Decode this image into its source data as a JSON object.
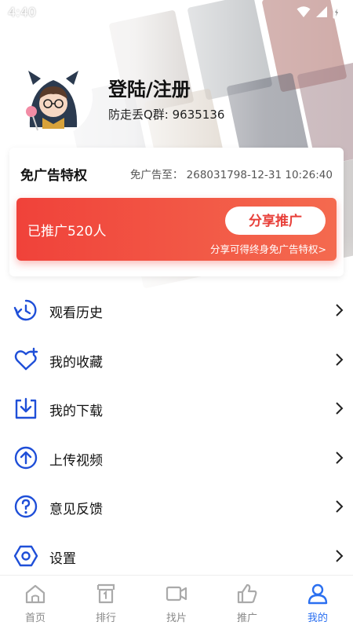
{
  "status_bar": {
    "time": "4:40"
  },
  "profile": {
    "title": "登陆/注册",
    "qq_group": "防走丢Q群: 9635136"
  },
  "adfree": {
    "title": "免广告特权",
    "until": "免广告至： 268031798-12-31 10:26:40",
    "promo": {
      "count_text": "已推广520人",
      "share_button": "分享推广",
      "hint": "分享可得终身免广告特权>"
    }
  },
  "menu": {
    "items": [
      {
        "label": "观看历史",
        "icon": "history-icon"
      },
      {
        "label": "我的收藏",
        "icon": "heart-plus-icon"
      },
      {
        "label": "我的下载",
        "icon": "download-icon"
      },
      {
        "label": "上传视频",
        "icon": "upload-icon"
      },
      {
        "label": "意见反馈",
        "icon": "question-icon"
      },
      {
        "label": "设置",
        "icon": "settings-icon"
      }
    ]
  },
  "bottom_nav": {
    "items": [
      {
        "label": "首页",
        "icon": "home-icon",
        "active": false
      },
      {
        "label": "排行",
        "icon": "ranking-icon",
        "active": false
      },
      {
        "label": "找片",
        "icon": "video-camera-icon",
        "active": false
      },
      {
        "label": "推广",
        "icon": "thumbs-up-icon",
        "active": false
      },
      {
        "label": "我的",
        "icon": "user-icon",
        "active": true
      }
    ]
  },
  "colors": {
    "accent_blue": "#2a6ff0",
    "menu_icon_blue": "#1f4fd8",
    "promo_red": "#f0423a",
    "share_text_red": "#e8403a"
  }
}
